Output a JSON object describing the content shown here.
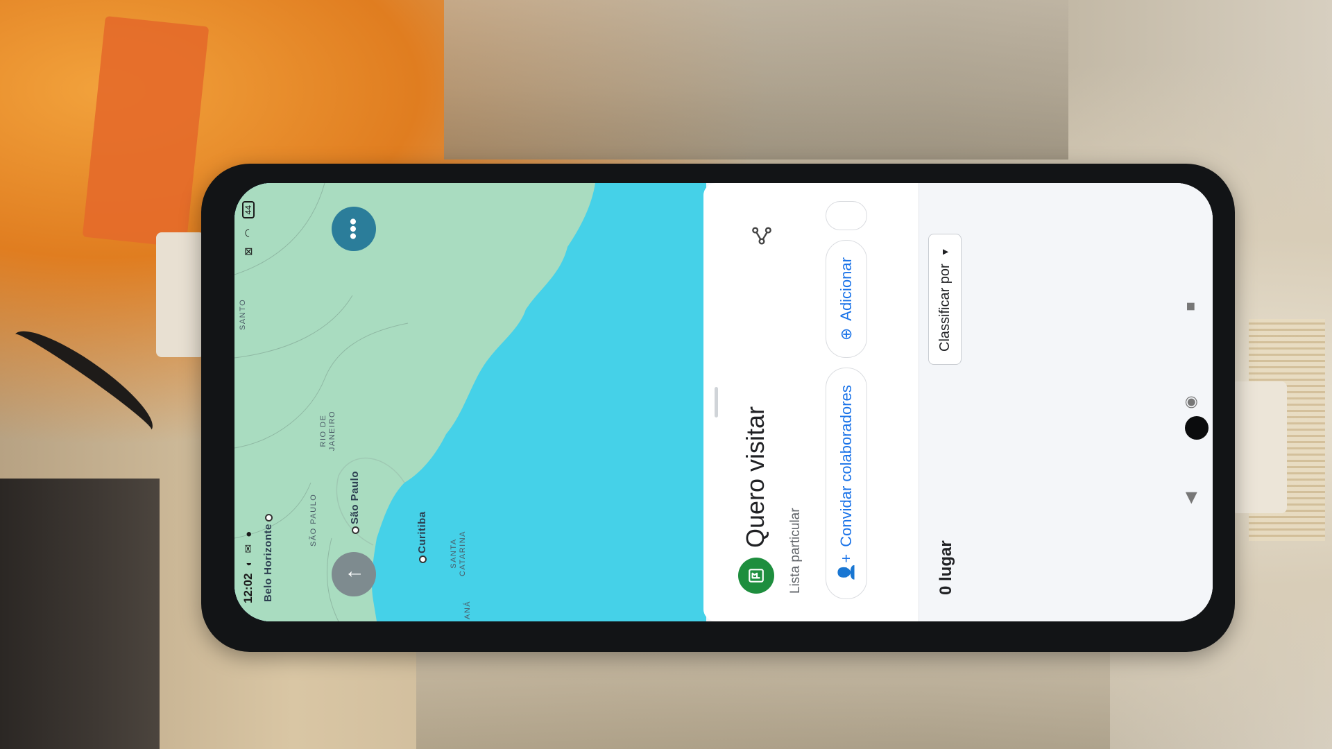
{
  "status_bar": {
    "time": "12:02",
    "battery": "44"
  },
  "map": {
    "labels": {
      "belo_horizonte": "Belo Horizonte",
      "sao_paulo_city": "São Paulo",
      "curitiba": "Curitiba",
      "sao_paulo_state": "SÃO PAULO",
      "rio_de_janeiro_state": "RIO DE JANEIRO",
      "santa_catarina_state": "SANTA CATARINA",
      "parana_state": "ANÁ",
      "espirito_santo_state": "SANTO"
    },
    "colors": {
      "water": "#45d1e8",
      "land": "#a9dcc0"
    }
  },
  "sheet": {
    "title": "Quero visitar",
    "subtitle": "Lista particular",
    "chips": {
      "invite_label": "Convidar colaboradores",
      "add_label": "Adicionar"
    },
    "place_count": "0 lugar",
    "sort_label": "Classificar por"
  },
  "icons": {
    "list": "flag-icon",
    "share": "share-icon",
    "compass": "arrow-up-icon",
    "more": "more-horizontal-icon",
    "invite": "person-add-icon",
    "add": "add-location-icon",
    "sort": "triangle-down-icon",
    "nav_back": "triangle-back-icon",
    "nav_home": "circle-home-icon",
    "nav_recents": "square-recents-icon"
  },
  "colors": {
    "accent_blue": "#1a73e8",
    "list_green": "#1e8e3e",
    "more_button": "#2b7d9a"
  }
}
